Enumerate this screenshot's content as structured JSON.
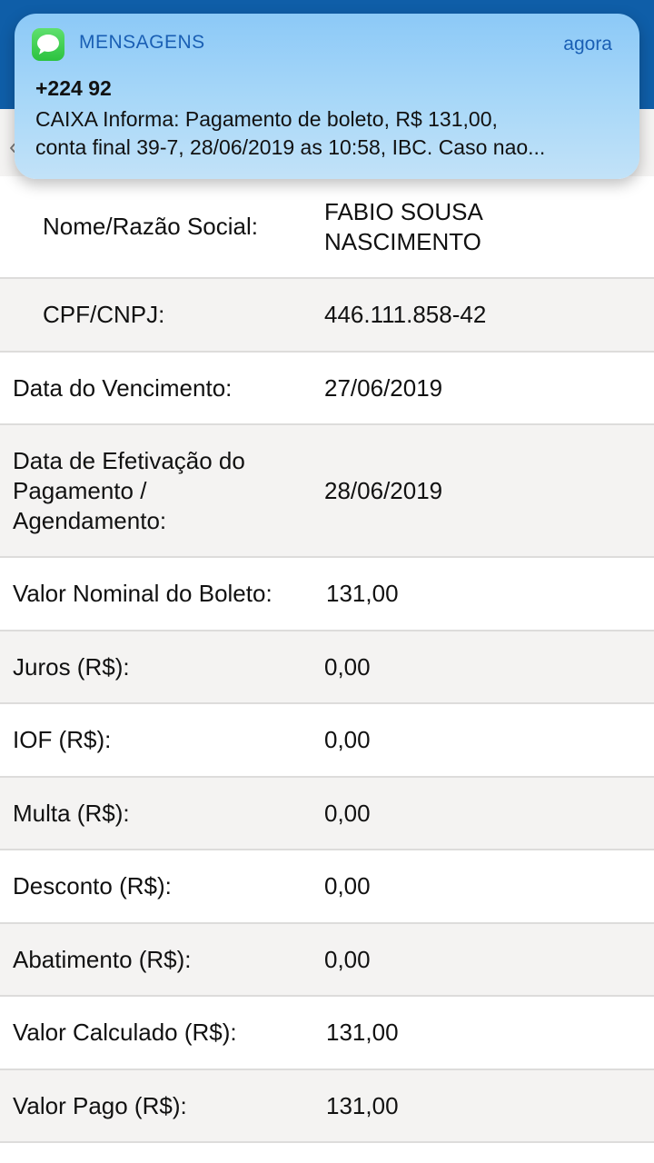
{
  "notification": {
    "app_name": "MENSAGENS",
    "time": "agora",
    "sender": "+224 92",
    "body_line1": "CAIXA Informa: Pagamento de boleto, R$ 131,00,",
    "body_line2": "conta final 39-7, 28/06/2019 as 10:58, IBC. Caso nao...",
    "icon": "messages-app-icon"
  },
  "colors": {
    "header": "#0f5ea8",
    "row_gray": "#f4f3f2",
    "row_white": "#ffffff",
    "notification_accent": "#1a5fb4"
  },
  "receipt": {
    "nome_label": "Nome/Razão Social:",
    "nome_value_line1": "FABIO SOUSA",
    "nome_value_line2": "NASCIMENTO",
    "cpf_label": "CPF/CNPJ:",
    "cpf_value": "446.111.858-42",
    "vencimento_label": "Data do Vencimento:",
    "vencimento_value": "27/06/2019",
    "efetivacao_label_line1": "Data de Efetivação do",
    "efetivacao_label_line2": "Pagamento /",
    "efetivacao_label_line3": "Agendamento:",
    "efetivacao_value": "28/06/2019",
    "valor_nominal_label": "Valor Nominal do Boleto:",
    "valor_nominal_value": "131,00",
    "juros_label": "Juros (R$):",
    "juros_value": "0,00",
    "iof_label": "IOF (R$):",
    "iof_value": "0,00",
    "multa_label": "Multa (R$):",
    "multa_value": "0,00",
    "desconto_label": "Desconto (R$):",
    "desconto_value": "0,00",
    "abatimento_label": "Abatimento (R$):",
    "abatimento_value": "0,00",
    "valor_calculado_label": "Valor Calculado (R$):",
    "valor_calculado_value": "131,00",
    "valor_pago_label": "Valor Pago (R$):",
    "valor_pago_value": "131,00"
  }
}
